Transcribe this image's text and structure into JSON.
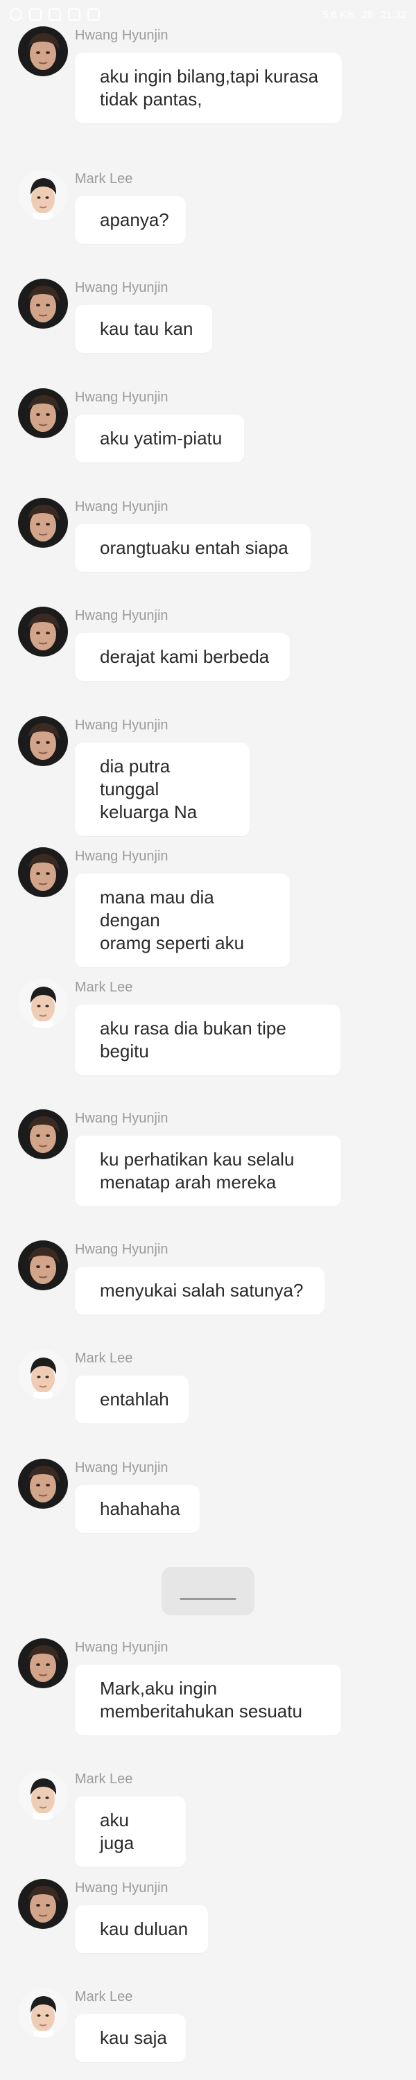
{
  "status_bar": {
    "time": "21:32",
    "network_speed": "5,6 K/s",
    "battery_percent": "28"
  },
  "messages": [
    {
      "sender": "Hwang Hyunjin",
      "avatar": "hyunjin-avatar",
      "text": "aku ingin bilang,tapi kurasa\ntidak pantas,"
    },
    {
      "sender": "Mark Lee",
      "avatar": "mark-avatar",
      "text": "apanya?"
    },
    {
      "sender": "Hwang Hyunjin",
      "avatar": "hyunjin-avatar",
      "text": "kau tau kan"
    },
    {
      "sender": "Hwang Hyunjin",
      "avatar": "hyunjin-avatar",
      "text": "aku yatim-piatu"
    },
    {
      "sender": "Hwang Hyunjin",
      "avatar": "hyunjin-avatar",
      "text": "orangtuaku entah siapa"
    },
    {
      "sender": "Hwang Hyunjin",
      "avatar": "hyunjin-avatar",
      "text": "derajat kami berbeda"
    },
    {
      "sender": "Hwang Hyunjin",
      "avatar": "hyunjin-avatar",
      "text": "dia putra tunggal\nkeluarga Na"
    },
    {
      "sender": "Hwang Hyunjin",
      "avatar": "hyunjin-avatar",
      "text": "mana mau dia dengan\noramg seperti aku"
    },
    {
      "sender": "Mark Lee",
      "avatar": "mark-avatar",
      "text": "aku rasa dia bukan tipe\nbegitu"
    },
    {
      "sender": "Hwang Hyunjin",
      "avatar": "hyunjin-avatar",
      "text": "ku perhatikan kau selalu\nmenatap arah mereka"
    },
    {
      "sender": "Hwang Hyunjin",
      "avatar": "hyunjin-avatar",
      "text": "menyukai salah satunya?"
    },
    {
      "sender": "Mark Lee",
      "avatar": "mark-avatar",
      "text": "entahlah"
    },
    {
      "sender": "Hwang Hyunjin",
      "avatar": "hyunjin-avatar",
      "text": "hahahaha"
    },
    {
      "sender": "Hwang Hyunjin",
      "avatar": "hyunjin-avatar",
      "text": "Mark,aku ingin\nmemberitahukan sesuatu"
    },
    {
      "sender": "Mark Lee",
      "avatar": "mark-avatar",
      "text": "aku juga"
    },
    {
      "sender": "Hwang Hyunjin",
      "avatar": "hyunjin-avatar",
      "text": "kau duluan"
    },
    {
      "sender": "Mark Lee",
      "avatar": "mark-avatar",
      "text": "kau saja"
    }
  ],
  "divider": {
    "text": "______"
  },
  "colors": {
    "background": "#f4f4f4",
    "bubble": "#ffffff",
    "sender_name": "#9b9b9b",
    "message_text": "#2a2a2a",
    "divider_pill": "#e6e6e6"
  }
}
